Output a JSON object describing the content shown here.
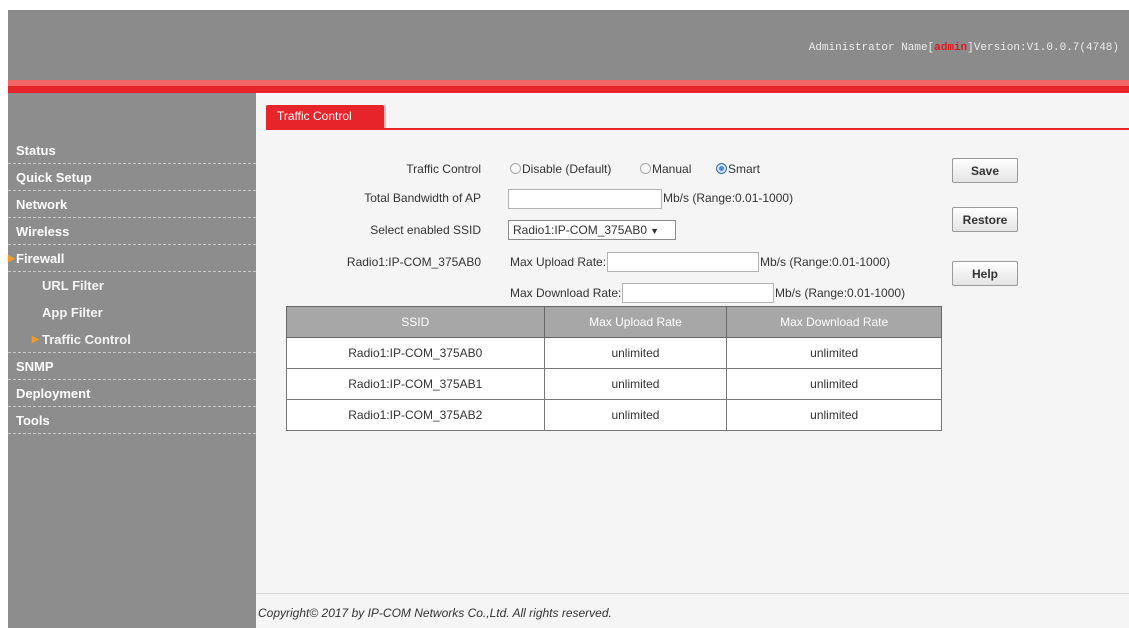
{
  "header": {
    "admin_prefix": "Administrator Name[",
    "admin_name": "admin",
    "version_text": "]Version:V1.0.0.7(4748)"
  },
  "sidebar": {
    "items": [
      {
        "label": "Status",
        "arrow": false
      },
      {
        "label": "Quick Setup",
        "arrow": false
      },
      {
        "label": "Network",
        "arrow": false
      },
      {
        "label": "Wireless",
        "arrow": false
      },
      {
        "label": "Firewall",
        "arrow": true,
        "arrow_icon": "triangle-right-icon"
      },
      {
        "label": "URL Filter",
        "sub": true
      },
      {
        "label": "App Filter",
        "sub": true
      },
      {
        "label": "Traffic Control",
        "sub": true,
        "arrow": true,
        "active": true,
        "arrow_icon": "triangle-right-icon"
      },
      {
        "label": "SNMP",
        "arrow": false
      },
      {
        "label": "Deployment",
        "arrow": false
      },
      {
        "label": "Tools",
        "arrow": false
      }
    ],
    "arrow_glyph": "▶",
    "arrow_color": "#f39c2b"
  },
  "tab": {
    "label": "Traffic Control"
  },
  "form": {
    "traffic_control_label": "Traffic Control",
    "options": [
      "Disable (Default)",
      "Manual",
      "Smart"
    ],
    "selected_option": "Smart",
    "bandwidth_label": "Total Bandwidth of AP",
    "bandwidth_value": "",
    "bandwidth_range": "Mb/s (Range:0.01-1000)",
    "ssid_select_label": "Select enabled SSID",
    "ssid_selected": "Radio1:IP-COM_375AB0",
    "ssid_caret": "▼",
    "radio_ssid_label": "Radio1:IP-COM_375AB0",
    "max_upload_label": "Max Upload Rate:",
    "max_upload_value": "",
    "max_upload_range": "Mb/s (Range:0.01-1000)",
    "max_download_label": "Max Download Rate:",
    "max_download_value": "",
    "max_download_range": "Mb/s (Range:0.01-1000)"
  },
  "buttons": {
    "save": "Save",
    "restore": "Restore",
    "help": "Help"
  },
  "table": {
    "headers": [
      "SSID",
      "Max Upload Rate",
      "Max Download Rate"
    ],
    "rows": [
      [
        "Radio1:IP-COM_375AB0",
        "unlimited",
        "unlimited"
      ],
      [
        "Radio1:IP-COM_375AB1",
        "unlimited",
        "unlimited"
      ],
      [
        "Radio1:IP-COM_375AB2",
        "unlimited",
        "unlimited"
      ]
    ]
  },
  "footer": {
    "text": "Copyright© 2017 by IP-COM Networks Co.,Ltd. All rights reserved."
  },
  "colors": {
    "accent_red": "#e8242b",
    "sidebar_bg": "#8d8d8d",
    "header_bg": "#8b8b8b",
    "admin_highlight": "#e8151c"
  }
}
